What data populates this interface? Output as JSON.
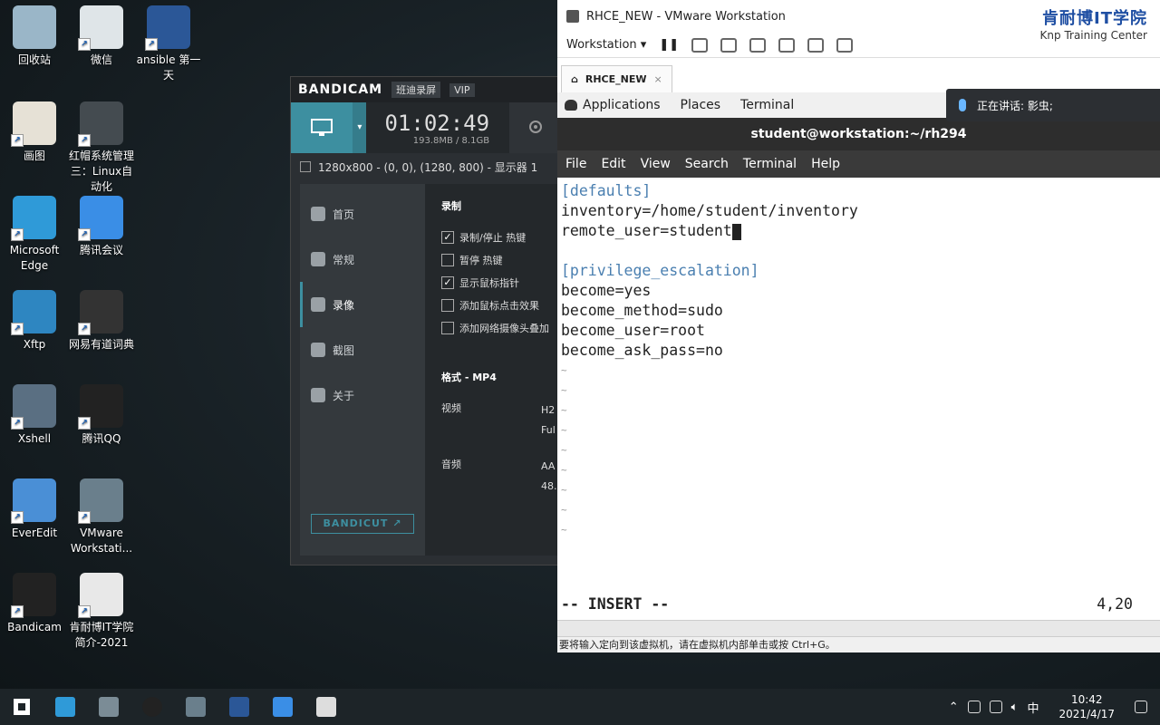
{
  "desktop_icons": [
    {
      "label": "回收站",
      "icon": "recycle-bin-icon",
      "color": "#9ab6c8"
    },
    {
      "label": "微信",
      "icon": "wechat-icon",
      "color": "#dfe5e8"
    },
    {
      "label": "ansible 第一天",
      "icon": "word-doc-icon",
      "color": "#2b5797"
    },
    {
      "label": "画图",
      "icon": "paint-icon",
      "color": "#e6e1d6"
    },
    {
      "label": "红帽系统管理三：Linux自动化",
      "icon": "video-file-icon",
      "color": "#444b50"
    },
    {
      "label": "Microsoft Edge",
      "icon": "edge-icon",
      "color": "#2f9ad8"
    },
    {
      "label": "腾讯会议",
      "icon": "tencent-meeting-icon",
      "color": "#3a8ee6"
    },
    {
      "label": "Xftp",
      "icon": "xftp-icon",
      "color": "#2e86c1"
    },
    {
      "label": "网易有道词典",
      "icon": "youdao-icon",
      "color": "#333"
    },
    {
      "label": "Xshell",
      "icon": "xshell-icon",
      "color": "#5a6f82"
    },
    {
      "label": "腾讯QQ",
      "icon": "qq-icon",
      "color": "#222"
    },
    {
      "label": "EverEdit",
      "icon": "everedit-icon",
      "color": "#4a8fd6"
    },
    {
      "label": "VMware Workstati...",
      "icon": "vmware-icon",
      "color": "#6a7f8c"
    },
    {
      "label": "Bandicam",
      "icon": "bandicam-icon",
      "color": "#222"
    },
    {
      "label": "肯耐博IT学院简介-2021",
      "icon": "pdf-thumb-icon",
      "color": "#e8e8e8"
    }
  ],
  "bandicam": {
    "brand": "BANDICAM",
    "badge1": "班迪录屏",
    "badge2": "VIP",
    "timer": "01:02:49",
    "size": "193.8MB / 8.1GB",
    "resolution": "1280x800 - (0, 0), (1280, 800) - 显示器 1",
    "nav": [
      "首页",
      "常规",
      "录像",
      "截图",
      "关于"
    ],
    "active_nav": 2,
    "section_title": "录制",
    "options": [
      {
        "label": "录制/停止 热键",
        "checked": "✓"
      },
      {
        "label": "暂停 热键",
        "checked": ""
      },
      {
        "label": "显示鼠标指针",
        "checked": "✓"
      },
      {
        "label": "添加鼠标点击效果",
        "checked": ""
      },
      {
        "label": "添加网络摄像头叠加",
        "checked": ""
      }
    ],
    "format_label": "格式 - MP4",
    "video_label": "视频",
    "video_val1": "H2",
    "video_val2": "Ful",
    "audio_label": "音频",
    "audio_val1": "AA",
    "audio_val2": "48.",
    "bandicut": "BANDICUT ↗"
  },
  "vmware": {
    "title": "RHCE_NEW - VMware Workstation",
    "menu_label": "Workstation ▾",
    "brand_cn": "肯耐博IT学院",
    "brand_en": "Knp Training Center",
    "tab_label": "RHCE_NEW",
    "gnome": {
      "apps": "Applications",
      "places": "Places",
      "terminal": "Terminal"
    },
    "speaking": "正在讲话: 影虫;",
    "term_title": "student@workstation:~/rh294",
    "term_menu": [
      "File",
      "Edit",
      "View",
      "Search",
      "Terminal",
      "Help"
    ],
    "lines": [
      {
        "text": "[defaults]",
        "kind": "section"
      },
      {
        "text": "inventory=/home/student/inventory",
        "kind": "normal"
      },
      {
        "text": "remote_user=student",
        "kind": "cursor"
      },
      {
        "text": "",
        "kind": "normal"
      },
      {
        "text": "[privilege_escalation]",
        "kind": "section"
      },
      {
        "text": "become=yes",
        "kind": "normal"
      },
      {
        "text": "become_method=sudo",
        "kind": "normal"
      },
      {
        "text": "become_user=root",
        "kind": "normal"
      },
      {
        "text": "become_ask_pass=no",
        "kind": "normal"
      }
    ],
    "tilde_count": 9,
    "mode": "-- INSERT --",
    "position": "4,20",
    "status": "要将输入定向到该虚拟机，请在虚拟机内部单击或按 Ctrl+G。"
  },
  "taskbar": {
    "time": "10:42",
    "date": "2021/4/17",
    "ime": "中",
    "apps": [
      "start-icon",
      "edge-taskbar-icon",
      "video-taskbar-icon",
      "bandicam-taskbar-icon",
      "vmware-taskbar-icon",
      "word-taskbar-icon",
      "tencent-meeting-taskbar-icon",
      "qq-taskbar-icon"
    ]
  }
}
